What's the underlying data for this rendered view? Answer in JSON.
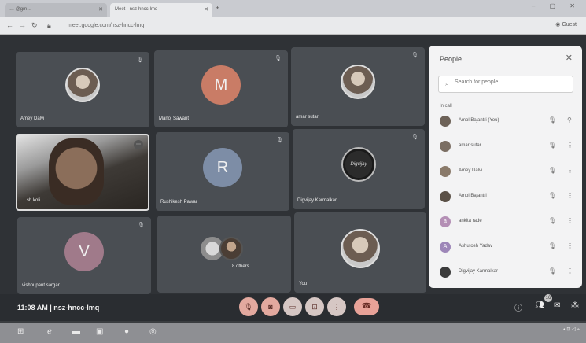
{
  "browser": {
    "tabs": [
      {
        "label": "… @gm…"
      },
      {
        "label": "Meet - nsz-hncc-lmq"
      }
    ],
    "new_tab": "+",
    "url": "meet.google.com/nsz-hncc-lmq",
    "profile": "Guest"
  },
  "tiles": [
    {
      "name": "Amey Dalvi",
      "type": "photo"
    },
    {
      "name": "Manoj Sawant",
      "type": "letter",
      "letter": "M"
    },
    {
      "name": "amar sutar",
      "type": "photo"
    },
    {
      "name": "…sh koli",
      "type": "video"
    },
    {
      "name": "Rushikesh Pawar",
      "type": "letter",
      "letter": "R"
    },
    {
      "name": "Digvijay Karmalkar",
      "type": "dark",
      "avatar_text": "Digvijay"
    },
    {
      "name": "vishnupant sargar",
      "type": "letter",
      "letter": "V"
    },
    {
      "name": "8 others",
      "type": "group"
    },
    {
      "name": "You",
      "type": "photo"
    }
  ],
  "people_panel": {
    "title": "People",
    "search_placeholder": "Search for people",
    "section": "In call",
    "participants": [
      {
        "name": "Amol Bajantri (You)",
        "avatar_color": "#6d6258"
      },
      {
        "name": "amar sutar",
        "avatar_color": "#7b6e63"
      },
      {
        "name": "Amey Dalvi",
        "avatar_color": "#8a7a6a"
      },
      {
        "name": "Amol Bajantri",
        "avatar_color": "#5a5046"
      },
      {
        "name": "ankita rade",
        "avatar_color": "#b48fb5",
        "letter": "a"
      },
      {
        "name": "Ashutosh Yadav",
        "avatar_color": "#9d86b8",
        "letter": "A"
      },
      {
        "name": "Digvijay Karmalkar",
        "avatar_color": "#3b3b3b"
      }
    ]
  },
  "controls": {
    "time": "11:08 AM",
    "separator": "|",
    "meeting_code": "nsz-hncc-lmq",
    "people_count": "16"
  },
  "colors": {
    "accent_button": "#e3a99f",
    "end_call": "#e8a298",
    "tile_bg": "#4a4e53"
  }
}
